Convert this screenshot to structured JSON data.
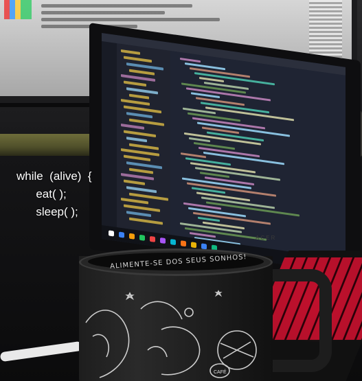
{
  "overlay": {
    "line1": "while  (alive)  {",
    "line2": "      eat( );",
    "line3": "      sleep( );"
  },
  "mug": {
    "slogan": "ALIMENTE-SE DOS SEUS SONHOS!",
    "label": "CAFÉ"
  },
  "laptop": {
    "brand": "ACER"
  },
  "colors": {
    "keyboard_backlight": "#c8102e",
    "shelf": "#6e6d3a",
    "overlay_text": "#ffffff"
  }
}
